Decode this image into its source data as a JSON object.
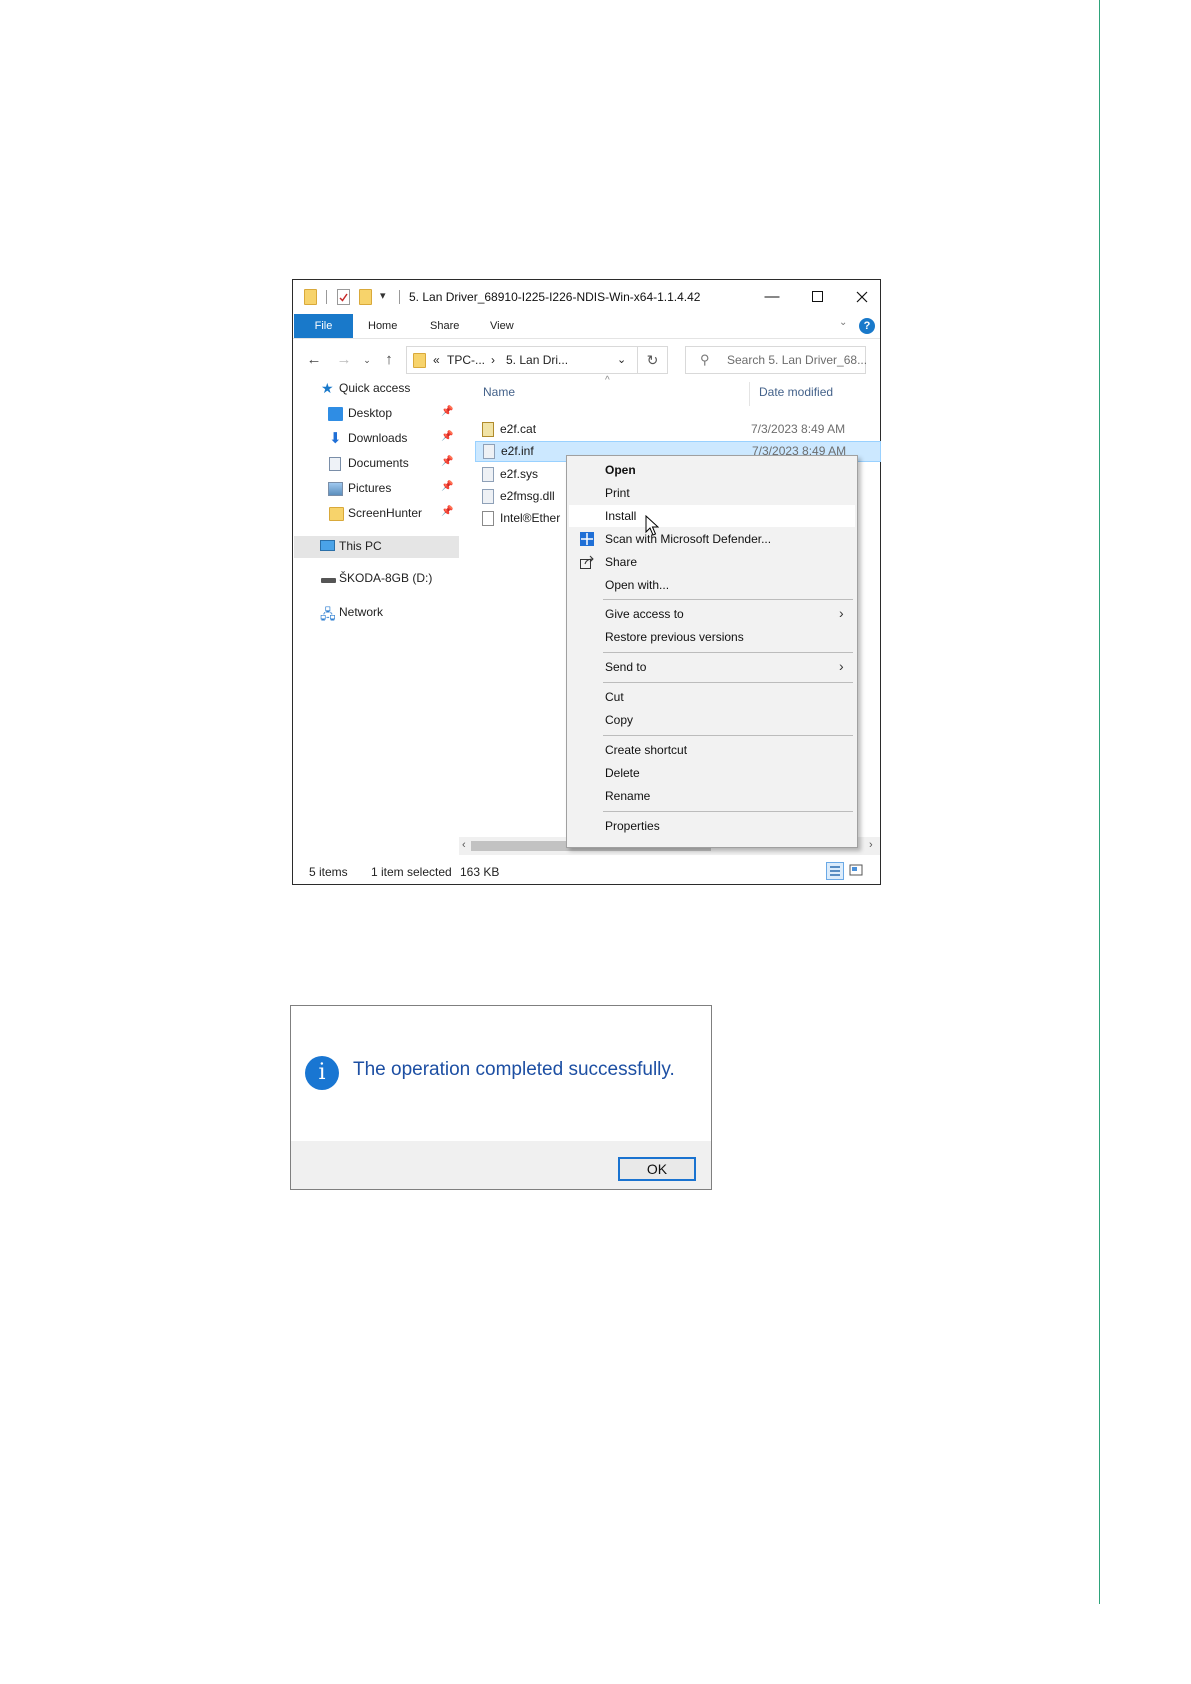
{
  "explorer": {
    "title": "5. Lan Driver_68910-I225-I226-NDIS-Win-x64-1.1.4.42",
    "ribbon_tabs": [
      "File",
      "Home",
      "Share",
      "View"
    ],
    "help_label": "?",
    "address": {
      "overflow": "«",
      "segment1": "TPC-...",
      "sep": "›",
      "segment2": "5. Lan Dri..."
    },
    "search_placeholder": "Search 5. Lan Driver_68...",
    "columns": {
      "name": "Name",
      "date_modified": "Date modified"
    },
    "sidebar": {
      "quick_access": "Quick access",
      "pinned": [
        "Desktop",
        "Downloads",
        "Documents",
        "Pictures",
        "ScreenHunter"
      ],
      "this_pc": "This PC",
      "drive": "ŠKODA-8GB (D:)",
      "network": "Network"
    },
    "files": [
      {
        "name": "e2f.cat",
        "date": "7/3/2023 8:49 AM"
      },
      {
        "name": "e2f.inf",
        "date": "7/3/2023 8:49 AM"
      },
      {
        "name": "e2f.sys"
      },
      {
        "name": "e2fmsg.dll"
      },
      {
        "name": "Intel®Ether"
      }
    ],
    "status": {
      "count": "5 items",
      "selected": "1 item selected",
      "size": "163 KB"
    }
  },
  "context_menu": {
    "items": [
      "Open",
      "Print",
      "Install",
      "Scan with Microsoft Defender...",
      "Share",
      "Open with...",
      "Give access to",
      "Restore previous versions",
      "Send to",
      "Cut",
      "Copy",
      "Create shortcut",
      "Delete",
      "Rename",
      "Properties"
    ]
  },
  "dialog": {
    "message": "The operation completed successfully.",
    "ok_label": "OK"
  },
  "colors": {
    "accent": "#1979ca",
    "rule": "#2ea37a",
    "selection": "#cce8ff"
  }
}
